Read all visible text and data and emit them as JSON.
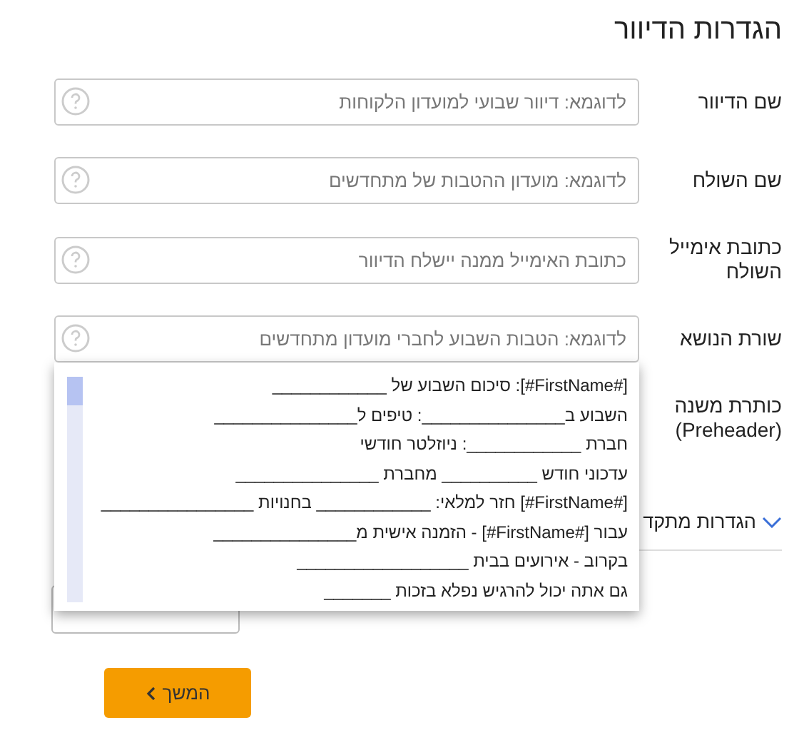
{
  "title": "הגדרות הדיוור",
  "fields": [
    {
      "label": "שם הדיוור",
      "placeholder": "לדוגמא: דיוור שבועי למועדון הלקוחות"
    },
    {
      "label": "שם השולח",
      "placeholder": "לדוגמא: מועדון ההטבות של מתחדשים"
    },
    {
      "label": "כתובת אימייל השולח",
      "placeholder": "כתובת האימייל ממנה יישלח הדיוור"
    },
    {
      "label": "שורת הנושא",
      "placeholder": "לדוגמא: הטבות השבוע לחברי מועדון מתחדשים"
    }
  ],
  "subject_suggestions": [
    "[#FirstName#]: סיכום השבוע של ____________",
    "השבוע ב_______________: טיפים ל_______________",
    "חברת ____________: ניוזלטר חודשי",
    "עדכוני חודש __________ מחברת _______________",
    "[#FirstName#] חזר למלאי: ____________ בחנויות ________________",
    "עבור [#FirstName#] - הזמנה אישית מ_______________",
    "בקרוב - אירועים בבית __________________",
    "גם אתה יכול להרגיש נפלא בזכות _______"
  ],
  "preheader": {
    "label": "כותרת משנה (Preheader)"
  },
  "advanced": {
    "label": "הגדרות מתקד"
  },
  "button": "המשך"
}
